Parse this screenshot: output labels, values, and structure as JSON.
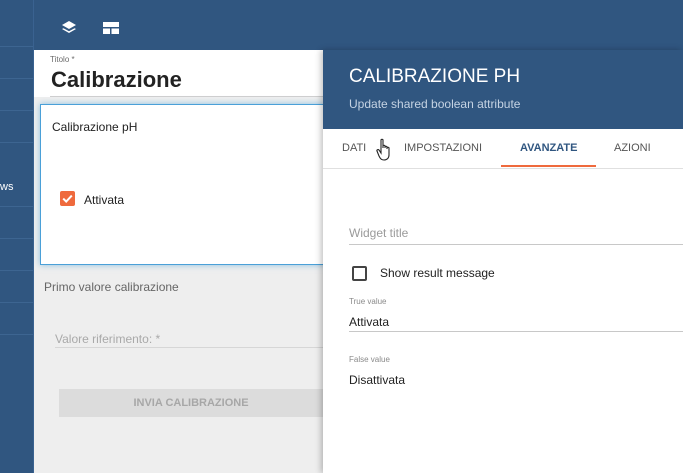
{
  "sidebar": {
    "partial_text": "ws"
  },
  "toolbar": {
    "icons": [
      "layers-icon",
      "dashboard-layout-icon"
    ]
  },
  "dashboard": {
    "title_label": "Titolo *",
    "title": "Calibrazione",
    "widget": {
      "title": "Calibrazione pH",
      "checkbox_label": "Attivata",
      "checked": true
    },
    "calibration_label": "Primo valore calibrazione",
    "reference_placeholder": "Valore riferimento: *",
    "send_button": "INVIA CALIBRAZIONE"
  },
  "panel": {
    "title": "CALIBRAZIONE PH",
    "subtitle": "Update shared boolean attribute",
    "tabs": [
      {
        "label": "DATI",
        "active": false
      },
      {
        "label": "IMPOSTAZIONI",
        "active": false
      },
      {
        "label": "AVANZATE",
        "active": true
      },
      {
        "label": "AZIONI",
        "active": false
      }
    ],
    "widget_title_placeholder": "Widget title",
    "show_result_label": "Show result message",
    "show_result_checked": false,
    "true_value_label": "True value",
    "true_value": "Attivata",
    "false_value_label": "False value",
    "false_value": "Disattivata"
  },
  "colors": {
    "primary": "#305680",
    "accent": "#ef6a3d",
    "focus_border": "#4aa0d8"
  }
}
